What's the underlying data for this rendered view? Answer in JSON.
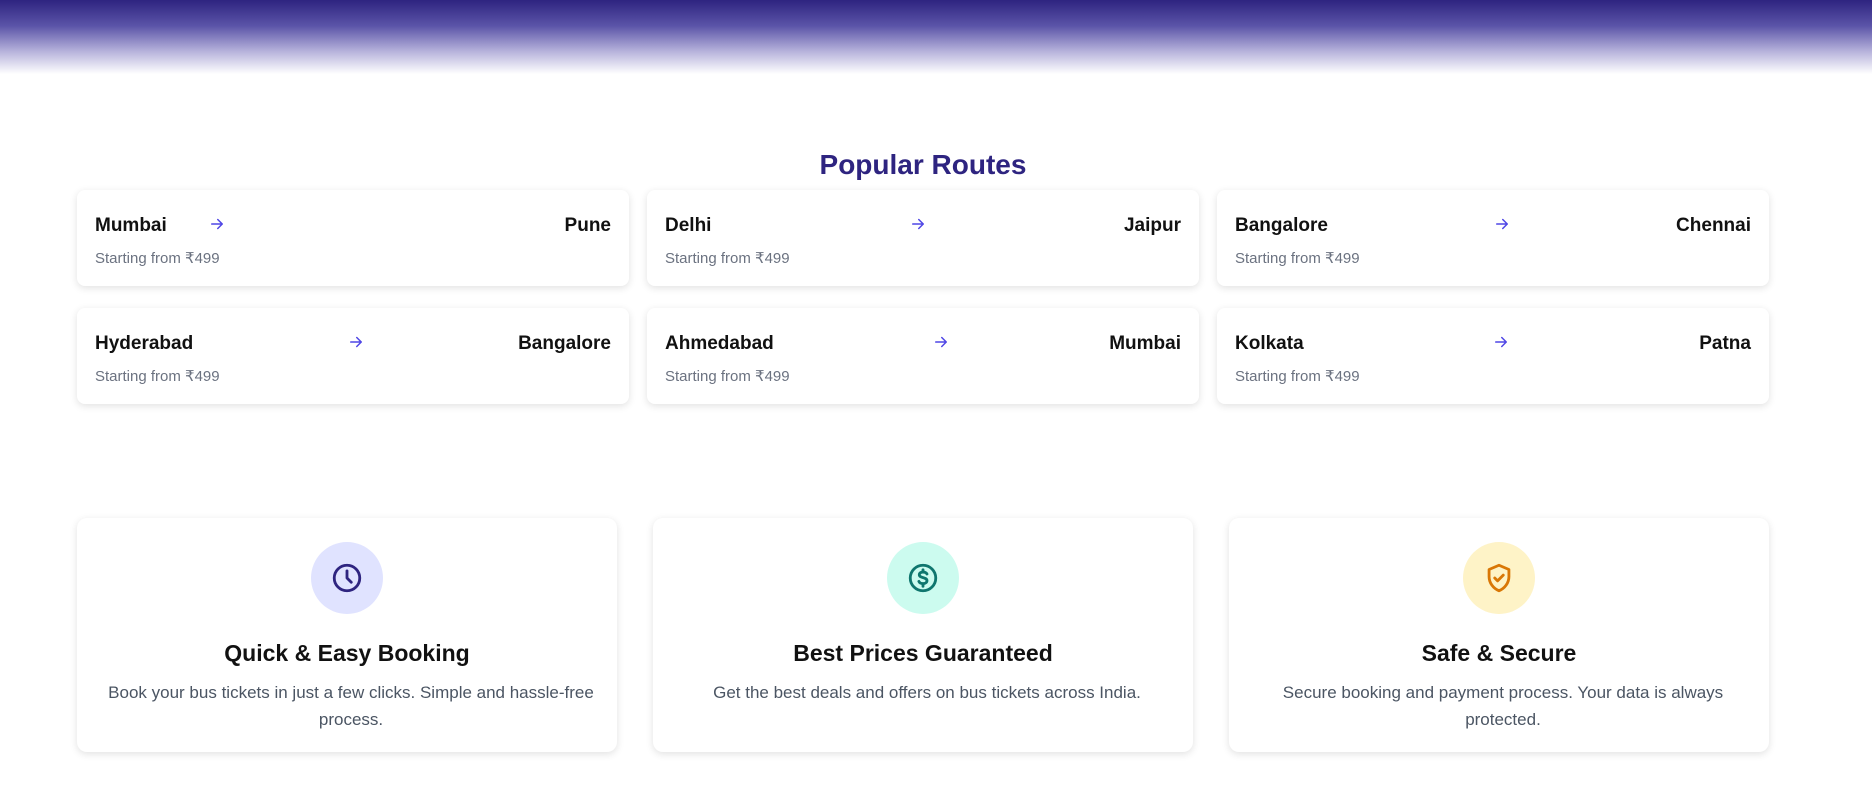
{
  "colors": {
    "brand": "#2e2480",
    "arrow": "#4f46e5",
    "clock_bg": "#e0e3ff",
    "clock_fg": "#2e2480",
    "dollar_bg": "#ccfbef",
    "dollar_fg": "#0f766e",
    "shield_bg": "#fef3c7",
    "shield_fg": "#d97706"
  },
  "popular_routes": {
    "title": "Popular Routes",
    "routes": [
      {
        "from": "Mumbai",
        "to": "Pune",
        "price": "Starting from ₹499",
        "icon": "arrow-right-icon"
      },
      {
        "from": "Delhi",
        "to": "Jaipur",
        "price": "Starting from ₹499",
        "icon": "arrow-right-icon"
      },
      {
        "from": "Bangalore",
        "to": "Chennai",
        "price": "Starting from ₹499",
        "icon": "arrow-right-icon"
      },
      {
        "from": "Hyderabad",
        "to": "Bangalore",
        "price": "Starting from ₹499",
        "icon": "arrow-right-icon"
      },
      {
        "from": "Ahmedabad",
        "to": "Mumbai",
        "price": "Starting from ₹499",
        "icon": "arrow-right-icon"
      },
      {
        "from": "Kolkata",
        "to": "Patna",
        "price": "Starting from ₹499",
        "icon": "arrow-right-icon"
      }
    ]
  },
  "features": [
    {
      "icon": "clock-icon",
      "title": "Quick & Easy Booking",
      "description": "Book your bus tickets in just a few clicks. Simple and hassle-free process."
    },
    {
      "icon": "dollar-icon",
      "title": "Best Prices Guaranteed",
      "description": "Get the best deals and offers on bus tickets across India."
    },
    {
      "icon": "shield-check-icon",
      "title": "Safe & Secure",
      "description": "Secure booking and payment process. Your data is always protected."
    }
  ]
}
